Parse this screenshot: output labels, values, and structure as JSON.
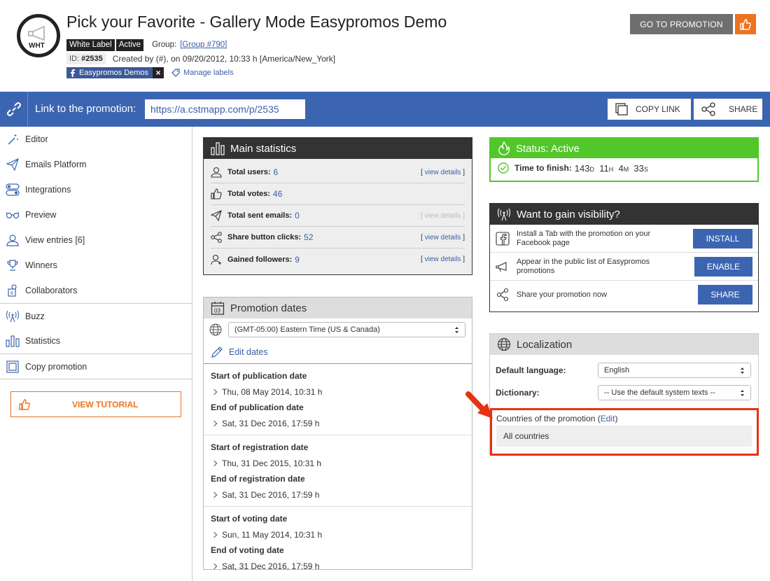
{
  "header": {
    "logo_text": "WHT",
    "title": "Pick your Favorite - Gallery Mode Easypromos Demo",
    "badges": [
      "White Label",
      "Active"
    ],
    "group_label": "Group:",
    "group_link": "[Group #790]",
    "id_label": "ID:",
    "id_value": "#2535",
    "created": "Created by (#), on 09/20/2012, 10:33 h [America/New_York]",
    "fb_label": "Easypromos Demos",
    "remove_label": "×",
    "manage_labels": "Manage labels",
    "go_button": "GO TO PROMOTION"
  },
  "linkbar": {
    "label": "Link to the promotion:",
    "url": "https://a.cstmapp.com/p/2535",
    "copy_link": "COPY LINK",
    "share": "SHARE"
  },
  "sidebar": {
    "items": [
      {
        "label": "Editor",
        "icon": "magic-wand-icon"
      },
      {
        "label": "Emails Platform",
        "icon": "paper-plane-icon"
      },
      {
        "label": "Integrations",
        "icon": "toggles-icon"
      },
      {
        "label": "Preview",
        "icon": "glasses-icon"
      },
      {
        "label": "View entries [6]",
        "icon": "user-icon"
      },
      {
        "label": "Winners",
        "icon": "trophy-icon"
      },
      {
        "label": "Collaborators",
        "icon": "collaborators-icon"
      },
      {
        "label": "Buzz",
        "icon": "broadcast-icon"
      },
      {
        "label": "Statistics",
        "icon": "bar-chart-icon"
      },
      {
        "label": "Copy promotion",
        "icon": "copy-icon"
      }
    ],
    "tutorial": "VIEW TUTORIAL"
  },
  "main_stats": {
    "title": "Main statistics",
    "rows": [
      {
        "label": "Total users:",
        "value": "6",
        "details": "view details"
      },
      {
        "label": "Total votes:",
        "value": "46",
        "details": ""
      },
      {
        "label": "Total sent emails:",
        "value": "0",
        "details": "view details"
      },
      {
        "label": "Share button clicks:",
        "value": "52",
        "details": "view details"
      },
      {
        "label": "Gained followers:",
        "value": "9",
        "details": "view details"
      }
    ]
  },
  "dates": {
    "title": "Promotion dates",
    "calendar_day": "03",
    "timezone": "(GMT-05:00) Eastern Time (US & Canada)",
    "edit": "Edit dates",
    "groups": [
      {
        "start_label": "Start of publication date",
        "start": "Thu, 08 May 2014, 10:31 h",
        "end_label": "End of publication date",
        "end": "Sat, 31 Dec 2016, 17:59 h"
      },
      {
        "start_label": "Start of registration date",
        "start": "Thu, 31 Dec 2015, 10:31 h",
        "end_label": "End of registration date",
        "end": "Sat, 31 Dec 2016, 17:59 h"
      },
      {
        "start_label": "Start of voting date",
        "start": "Sun, 11 May 2014, 10:31 h",
        "end_label": "End of voting date",
        "end": "Sat, 31 Dec 2016, 17:59 h"
      }
    ]
  },
  "status": {
    "title": "Status: Active",
    "time_label": "Time to finish:",
    "days": "143",
    "days_unit": "D",
    "hours": "11",
    "hours_unit": "H",
    "minutes": "4",
    "minutes_unit": "M",
    "seconds": "33",
    "seconds_unit": "S"
  },
  "visibility": {
    "title": "Want to gain visibility?",
    "rows": [
      {
        "text": "Install a Tab with the promotion on your Facebook page",
        "button": "INSTALL"
      },
      {
        "text": "Appear in the public list of Easypromos promotions",
        "button": "ENABLE"
      },
      {
        "text": "Share your promotion now",
        "button": "SHARE"
      }
    ]
  },
  "localization": {
    "title": "Localization",
    "lang_label": "Default language:",
    "lang_value": "English",
    "dict_label": "Dictionary:",
    "dict_value": "-- Use the default system texts --",
    "countries_label": "Countries of the promotion (",
    "countries_edit": "Edit",
    "countries_close": ")",
    "countries_value": "All countries"
  },
  "colors": {
    "brand_blue": "#3c65b1",
    "orange": "#ef7221",
    "status_green": "#52c72a",
    "highlight_red": "#e63212"
  }
}
